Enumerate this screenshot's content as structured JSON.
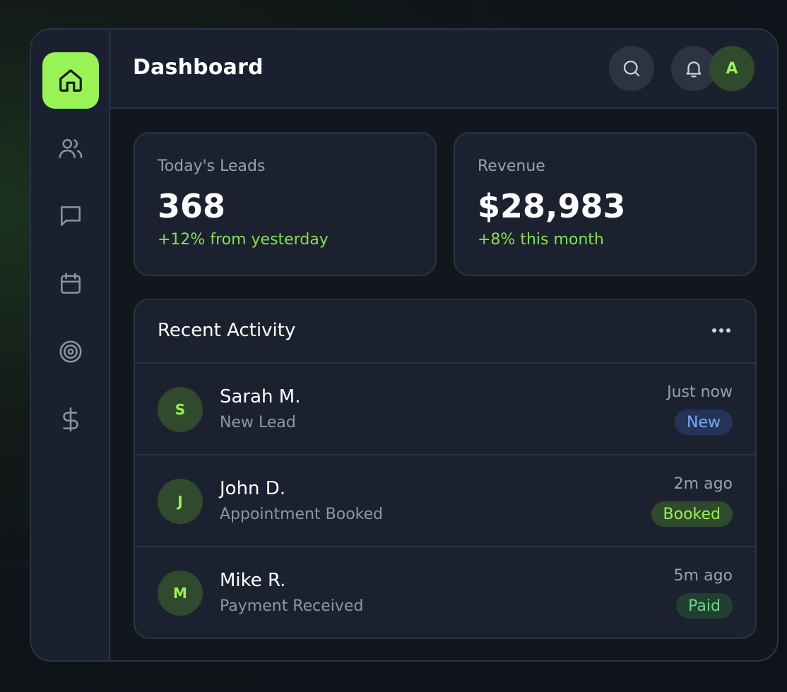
{
  "header": {
    "title": "Dashboard",
    "user_initial": "A"
  },
  "sidebar": {
    "items": [
      {
        "name": "home",
        "icon": "home-icon",
        "active": true
      },
      {
        "name": "users",
        "icon": "users-icon",
        "active": false
      },
      {
        "name": "messages",
        "icon": "message-icon",
        "active": false
      },
      {
        "name": "calendar",
        "icon": "calendar-icon",
        "active": false
      },
      {
        "name": "targets",
        "icon": "target-icon",
        "active": false
      },
      {
        "name": "billing",
        "icon": "dollar-icon",
        "active": false
      }
    ]
  },
  "stats": {
    "leads": {
      "label": "Today's Leads",
      "value": "368",
      "delta": "+12% from yesterday"
    },
    "revenue": {
      "label": "Revenue",
      "value": "$28,983",
      "delta": "+8% this month"
    }
  },
  "activity": {
    "title": "Recent Activity",
    "rows": [
      {
        "initial": "S",
        "name": "Sarah M.",
        "action": "New Lead",
        "time": "Just now",
        "badge": "New"
      },
      {
        "initial": "J",
        "name": "John D.",
        "action": "Appointment Booked",
        "time": "2m ago",
        "badge": "Booked"
      },
      {
        "initial": "M",
        "name": "Mike R.",
        "action": "Payment Received",
        "time": "5m ago",
        "badge": "Paid"
      }
    ]
  },
  "colors": {
    "accent": "#98f355",
    "positive": "#84e04a",
    "card": "#1c2130",
    "border": "#2c3342",
    "badge_new": "#7ea6f2",
    "badge_paid": "#6fd690"
  }
}
